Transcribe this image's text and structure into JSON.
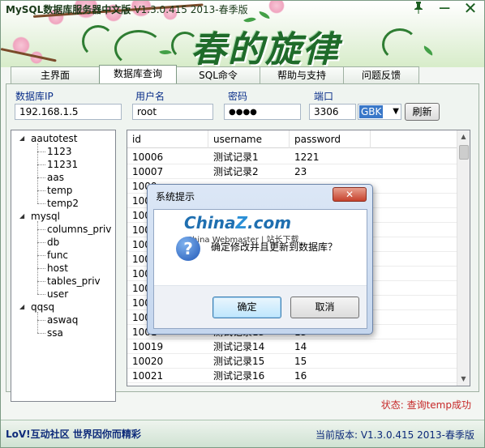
{
  "window": {
    "title": "MySQL数据库服务器中文版",
    "version_title": "V1.3.0.415 2013-春季版",
    "banner_art_text": "春的旋律",
    "pin_icon": "pin-icon",
    "minimize_glyph": "─",
    "close_glyph": "✕"
  },
  "tabs": [
    {
      "label": "主界面"
    },
    {
      "label": "数据库查询"
    },
    {
      "label": "SQL命令"
    },
    {
      "label": "帮助与支持"
    },
    {
      "label": "问题反馈"
    }
  ],
  "connection": {
    "ip_label": "数据库IP",
    "ip_value": "192.168.1.5",
    "user_label": "用户名",
    "user_value": "root",
    "password_label": "密码",
    "password_value": "●●●●",
    "port_label": "端口",
    "port_value": "3306",
    "charset_value": "GBK",
    "refresh_label": "刷新"
  },
  "tree": {
    "databases": [
      {
        "name": "aautotest",
        "tables": [
          "1123",
          "11231",
          "aas",
          "temp",
          "temp2"
        ]
      },
      {
        "name": "mysql",
        "tables": [
          "columns_priv",
          "db",
          "func",
          "host",
          "tables_priv",
          "user"
        ]
      },
      {
        "name": "qqsq",
        "tables": [
          "aswaq",
          "ssa"
        ]
      }
    ]
  },
  "grid": {
    "columns": [
      "id",
      "username",
      "password"
    ],
    "rows": [
      [
        "10006",
        "测试记录1",
        "1221"
      ],
      [
        "10007",
        "测试记录2",
        "23"
      ],
      [
        "1000",
        "",
        ""
      ],
      [
        "100",
        "",
        ""
      ],
      [
        "100",
        "",
        ""
      ],
      [
        "100",
        "",
        ""
      ],
      [
        "100",
        "",
        ""
      ],
      [
        "100",
        "",
        ""
      ],
      [
        "100",
        "",
        ""
      ],
      [
        "100",
        "",
        ""
      ],
      [
        "100",
        "",
        ""
      ],
      [
        "100",
        "",
        ""
      ],
      [
        "1001",
        "测试记录13",
        "13"
      ],
      [
        "10019",
        "测试记录14",
        "14"
      ],
      [
        "10020",
        "测试记录15",
        "15"
      ],
      [
        "10021",
        "测试记录16",
        "16"
      ]
    ]
  },
  "status": {
    "message": "状态: 查询temp成功"
  },
  "footer": {
    "left": "LoV!互动社区 世界因你而精彩",
    "right": "当前版本: V1.3.0.415 2013-春季版"
  },
  "dialog": {
    "title": "系统提示",
    "close_glyph": "✕",
    "watermark_logo_a": "China",
    "watermark_logo_z": "Z",
    "watermark_logo_b": ".com",
    "watermark_sub": "China Webmaster | 站长下载",
    "icon": "question-icon",
    "message": "确定修改并且更新到数据库？",
    "ok_label": "确定",
    "cancel_label": "取消"
  }
}
